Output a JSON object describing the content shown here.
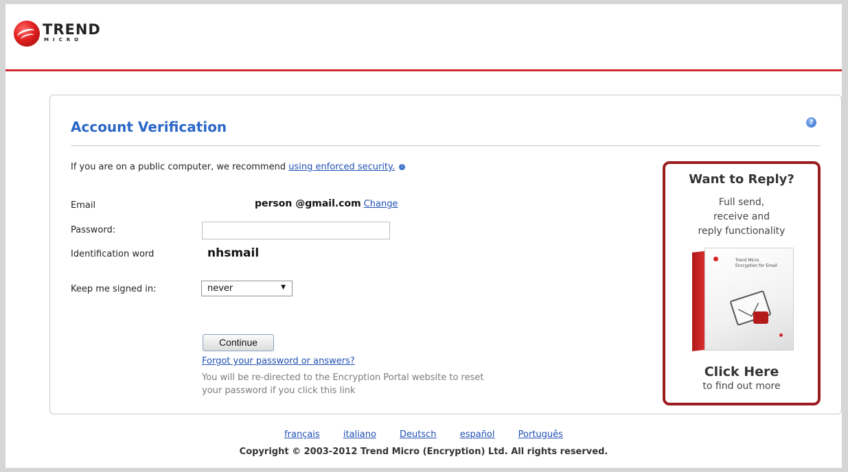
{
  "header": {
    "logo_line1": "TREND",
    "logo_line2": "MICRO",
    "accent_color": "#d0282b"
  },
  "form": {
    "title": "Account Verification",
    "notice_text": "If you are on a public computer, we recommend ",
    "notice_link": "using enforced security.",
    "email_label": "Email",
    "email_value": "person @gmail.com",
    "email_change": "Change",
    "password_label": "Password:",
    "password_value": "",
    "ident_label": "Identification word",
    "ident_value": "nhsmail",
    "keep_label": "Keep me signed in:",
    "keep_value": "never",
    "continue_label": "Continue",
    "forgot_link": "Forgot your password or answers?",
    "redirect_line1": "You will be re-directed to the Encryption Portal website to reset",
    "redirect_line2": "your password if you click this link"
  },
  "promo": {
    "title": "Want to Reply?",
    "sub1": "Full send,",
    "sub2": "receive and",
    "sub3": "reply functionality",
    "box_line1": "Trend Micro",
    "box_line2": "Encryption for Email",
    "click": "Click Here",
    "more": "to find out more"
  },
  "footer": {
    "languages": [
      "français",
      "italiano",
      "Deutsch",
      "español",
      "Português"
    ],
    "copyright": "Copyright © 2003-2012 Trend Micro (Encryption) Ltd. All rights reserved."
  }
}
